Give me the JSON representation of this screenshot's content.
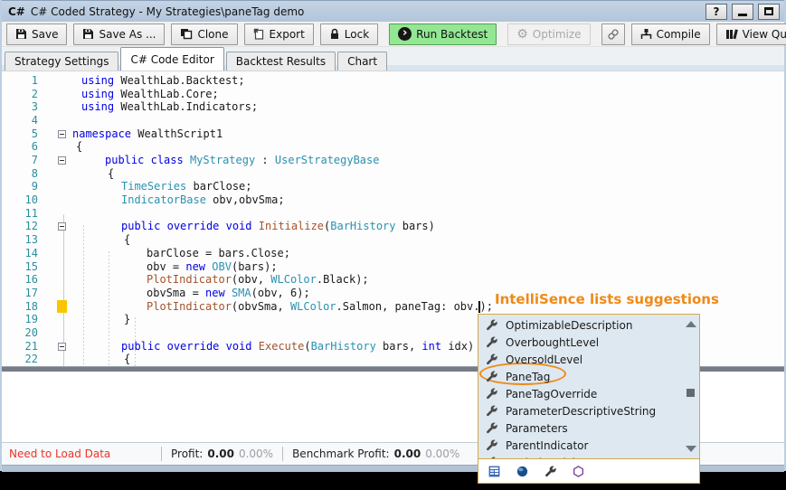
{
  "window": {
    "icon_text": "C#",
    "title": "C# Coded Strategy - My Strategies\\paneTag demo",
    "help_label": "?"
  },
  "toolbar": {
    "buttons": [
      {
        "label": "Save",
        "icon": "save-icon"
      },
      {
        "label": "Save As ...",
        "icon": "save-as-icon"
      },
      {
        "label": "Clone",
        "icon": "clone-icon"
      },
      {
        "label": "Export",
        "icon": "export-icon"
      },
      {
        "label": "Lock",
        "icon": "lock-icon"
      },
      {
        "label": "Run Backtest",
        "icon": "run-icon"
      },
      {
        "label": "Optimize",
        "icon": "optimize-icon",
        "disabled": true
      },
      {
        "label": "",
        "icon": "link-icon"
      },
      {
        "label": "Compile",
        "icon": "compile-icon"
      },
      {
        "label": "View QuickRef",
        "icon": "quickref-icon"
      }
    ]
  },
  "tabs": {
    "items": [
      {
        "label": "Strategy Settings"
      },
      {
        "label": "C# Code Editor"
      },
      {
        "label": "Backtest Results"
      },
      {
        "label": "Chart"
      }
    ],
    "active": "C# Code Editor"
  },
  "editor": {
    "lines": [
      {
        "n": 1,
        "ind": "u",
        "tks": [
          [
            "k",
            "using"
          ],
          [
            "p",
            " WealthLab.Backtest;"
          ]
        ]
      },
      {
        "n": 2,
        "ind": "u",
        "tks": [
          [
            "k",
            "using"
          ],
          [
            "p",
            " WealthLab.Core;"
          ]
        ]
      },
      {
        "n": 3,
        "ind": "u",
        "tks": [
          [
            "k",
            "using"
          ],
          [
            "p",
            " WealthLab.Indicators;"
          ]
        ]
      },
      {
        "n": 4,
        "ind": "u",
        "tks": []
      },
      {
        "n": 5,
        "ind": "n0",
        "fold": true,
        "tks": [
          [
            "k",
            "namespace"
          ],
          [
            "p",
            " WealthScript1"
          ]
        ]
      },
      {
        "n": 6,
        "ind": "b0",
        "tks": [
          [
            "p",
            "{"
          ]
        ]
      },
      {
        "n": 7,
        "ind": "l1",
        "fold": true,
        "tks": [
          [
            "k",
            "public"
          ],
          [
            "p",
            " "
          ],
          [
            "k",
            "class"
          ],
          [
            "p",
            " "
          ],
          [
            "t",
            "MyStrategy"
          ],
          [
            "p",
            " : "
          ],
          [
            "t",
            "UserStrategyBase"
          ]
        ]
      },
      {
        "n": 8,
        "ind": "b1",
        "tks": [
          [
            "p",
            "{"
          ]
        ]
      },
      {
        "n": 9,
        "ind": "l2",
        "tks": [
          [
            "t",
            "TimeSeries"
          ],
          [
            "p",
            " barClose;"
          ]
        ]
      },
      {
        "n": 10,
        "ind": "l2",
        "tks": [
          [
            "t",
            "IndicatorBase"
          ],
          [
            "p",
            " obv,obvSma;"
          ]
        ]
      },
      {
        "n": 11,
        "ind": "l2",
        "tks": []
      },
      {
        "n": 12,
        "ind": "l2",
        "fold": true,
        "tks": [
          [
            "k",
            "public"
          ],
          [
            "p",
            " "
          ],
          [
            "k",
            "override"
          ],
          [
            "p",
            " "
          ],
          [
            "k",
            "void"
          ],
          [
            "p",
            " "
          ],
          [
            "m",
            "Initialize"
          ],
          [
            "p",
            "("
          ],
          [
            "t",
            "BarHistory"
          ],
          [
            "p",
            " bars)"
          ]
        ]
      },
      {
        "n": 13,
        "ind": "b2",
        "tks": [
          [
            "p",
            "{"
          ]
        ]
      },
      {
        "n": 14,
        "ind": "l3",
        "tks": [
          [
            "p",
            "barClose = bars.Close;"
          ]
        ]
      },
      {
        "n": 15,
        "ind": "l3",
        "tks": [
          [
            "p",
            "obv = "
          ],
          [
            "k",
            "new"
          ],
          [
            "p",
            " "
          ],
          [
            "t",
            "OBV"
          ],
          [
            "p",
            "(bars);"
          ]
        ]
      },
      {
        "n": 16,
        "ind": "l3",
        "tks": [
          [
            "m",
            "PlotIndicator"
          ],
          [
            "p",
            "(obv, "
          ],
          [
            "t",
            "WLColor"
          ],
          [
            "p",
            ".Black);"
          ]
        ]
      },
      {
        "n": 17,
        "ind": "l3",
        "tks": [
          [
            "p",
            "obvSma = "
          ],
          [
            "k",
            "new"
          ],
          [
            "p",
            " "
          ],
          [
            "t",
            "SMA"
          ],
          [
            "p",
            "(obv, 6);"
          ]
        ]
      },
      {
        "n": 18,
        "ind": "l3",
        "chg": true,
        "tks": [
          [
            "m",
            "PlotIndicator"
          ],
          [
            "p",
            "(obvSma, "
          ],
          [
            "t",
            "WLColor"
          ],
          [
            "p",
            ".Salmon, paneTag: obv."
          ],
          [
            "c",
            ""
          ],
          [
            "p",
            ");"
          ]
        ]
      },
      {
        "n": 19,
        "ind": "b2",
        "tks": [
          [
            "p",
            "}"
          ]
        ]
      },
      {
        "n": 20,
        "ind": "l2",
        "tks": []
      },
      {
        "n": 21,
        "ind": "l2",
        "fold": true,
        "tks": [
          [
            "k",
            "public"
          ],
          [
            "p",
            " "
          ],
          [
            "k",
            "override"
          ],
          [
            "p",
            " "
          ],
          [
            "k",
            "void"
          ],
          [
            "p",
            " "
          ],
          [
            "m",
            "Execute"
          ],
          [
            "p",
            "("
          ],
          [
            "t",
            "BarHistory"
          ],
          [
            "p",
            " bars, "
          ],
          [
            "k",
            "int"
          ],
          [
            "p",
            " idx)"
          ]
        ]
      },
      {
        "n": 22,
        "ind": "b2",
        "tks": [
          [
            "p",
            "{"
          ]
        ]
      }
    ]
  },
  "intellisense": {
    "items": [
      "OptimizableDescription",
      "OverboughtLevel",
      "OversoldLevel",
      "PaneTag",
      "PaneTagOverride",
      "ParameterDescriptiveString",
      "Parameters",
      "ParentIndicator",
      "PeekAheadFlag"
    ],
    "circled_item": "PaneTag",
    "item_icon": "wrench-icon",
    "footer_icons": [
      "grid-icon",
      "sphere-icon",
      "wrench-icon",
      "hexagon-icon"
    ]
  },
  "annotation": {
    "text": "IntelliSence lists suggestions"
  },
  "status_bar": {
    "message": "Need to Load Data",
    "profit_label": "Profit:",
    "profit_value": "0.00",
    "profit_pct": "0.00%",
    "benchmark_label": "Benchmark Profit:",
    "benchmark_value": "0.00",
    "benchmark_pct": "0.00%"
  },
  "colors": {
    "titlebar": "#b2c5da",
    "titlebar_light": "#c5d4e5",
    "run_green": "#93e793",
    "annotation_orange": "#ef8a16",
    "keyword": "#0000e6",
    "type": "#2b91af",
    "method": "#a3542c",
    "line_number": "#2b8f9e",
    "error_red": "#f03228",
    "popup_bg": "#dde8f0",
    "popup_border": "#d4a84b",
    "marker_yellow": "#f7c600"
  }
}
